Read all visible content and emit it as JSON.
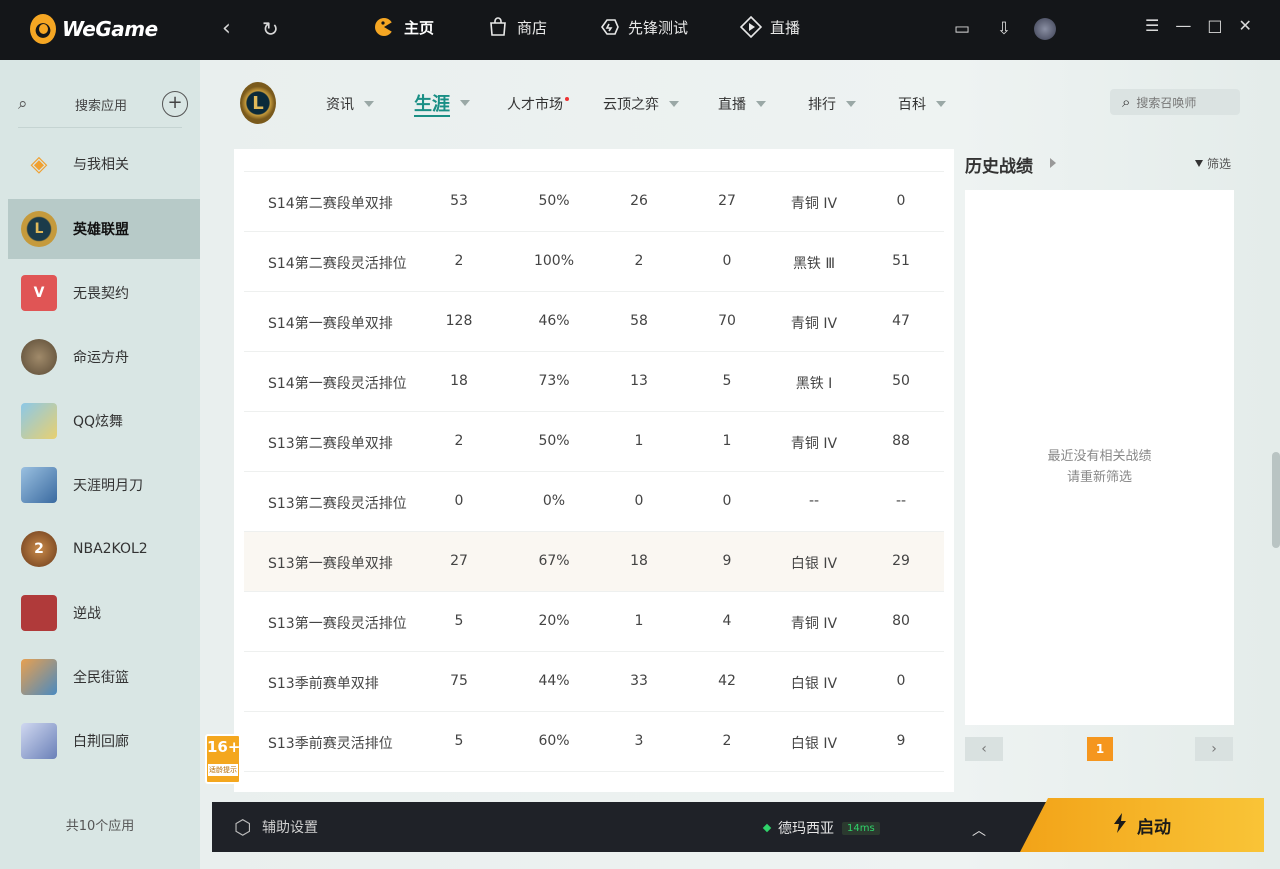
{
  "app": {
    "name": "WeGame"
  },
  "topnav": {
    "items": [
      {
        "label": "主页",
        "icon": "gamepad-icon"
      },
      {
        "label": "商店",
        "icon": "shop-bag-icon"
      },
      {
        "label": "先锋测试",
        "icon": "test-icon"
      },
      {
        "label": "直播",
        "icon": "live-icon"
      }
    ]
  },
  "sidebar": {
    "search_label": "搜索应用",
    "games": [
      {
        "label": "与我相关",
        "color": "#f0a030"
      },
      {
        "label": "英雄联盟",
        "color": "#1b3b4a"
      },
      {
        "label": "无畏契约",
        "color": "#e05555"
      },
      {
        "label": "命运方舟",
        "color": "#7d6a4f"
      },
      {
        "label": "QQ炫舞",
        "color": "#6ab0d8"
      },
      {
        "label": "天涯明月刀",
        "color": "#5a8cc0"
      },
      {
        "label": "NBA2KOL2",
        "color": "#a06a3a"
      },
      {
        "label": "逆战",
        "color": "#c04040"
      },
      {
        "label": "全民街篮",
        "color": "#5aa0c8"
      },
      {
        "label": "白荆回廊",
        "color": "#8aa0c8"
      }
    ],
    "count_label": "共10个应用"
  },
  "subnav": {
    "items": [
      {
        "label": "资讯"
      },
      {
        "label": "生涯"
      },
      {
        "label": "人才市场"
      },
      {
        "label": "云顶之弈"
      },
      {
        "label": "直播"
      },
      {
        "label": "排行"
      },
      {
        "label": "百科"
      }
    ],
    "search_placeholder": "搜索召唤师"
  },
  "table": {
    "rows": [
      [
        "S14第二赛段单双排",
        "53",
        "50%",
        "26",
        "27",
        "青铜 IV",
        "0"
      ],
      [
        "S14第二赛段灵活排位",
        "2",
        "100%",
        "2",
        "0",
        "黑铁 Ⅲ",
        "51"
      ],
      [
        "S14第一赛段单双排",
        "128",
        "46%",
        "58",
        "70",
        "青铜 IV",
        "47"
      ],
      [
        "S14第一赛段灵活排位",
        "18",
        "73%",
        "13",
        "5",
        "黑铁 Ⅰ",
        "50"
      ],
      [
        "S13第二赛段单双排",
        "2",
        "50%",
        "1",
        "1",
        "青铜 IV",
        "88"
      ],
      [
        "S13第二赛段灵活排位",
        "0",
        "0%",
        "0",
        "0",
        "--",
        "--"
      ],
      [
        "S13第一赛段单双排",
        "27",
        "67%",
        "18",
        "9",
        "白银 IV",
        "29"
      ],
      [
        "S13第一赛段灵活排位",
        "5",
        "20%",
        "1",
        "4",
        "青铜 IV",
        "80"
      ],
      [
        "S13季前赛单双排",
        "75",
        "44%",
        "33",
        "42",
        "白银 IV",
        "0"
      ],
      [
        "S13季前赛灵活排位",
        "5",
        "60%",
        "3",
        "2",
        "白银 IV",
        "9"
      ]
    ]
  },
  "history": {
    "title": "历史战绩",
    "filter_label": "筛选",
    "empty_line1": "最近没有相关战绩",
    "empty_line2": "请重新筛选",
    "page": "1"
  },
  "age_badge": {
    "rating": "16+",
    "caption": "适龄提示"
  },
  "bottom": {
    "assist_label": "辅助设置",
    "server": "德玛西亚",
    "ping": "14ms",
    "launch_label": "启动"
  },
  "colors": {
    "accent": "#1a8f85",
    "launch": "#f5a623",
    "page_active": "#f5961e"
  }
}
